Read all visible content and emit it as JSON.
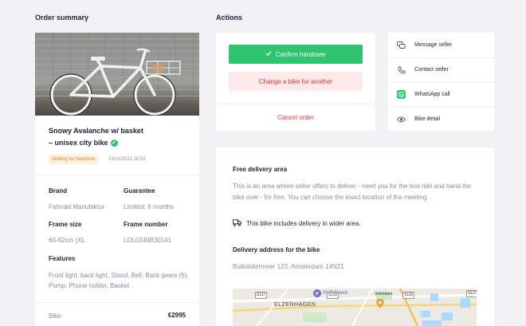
{
  "sections": {
    "order_summary": "Order summary",
    "actions": "Actions"
  },
  "order": {
    "title_line1": "Snowy Avalanche w/ basket",
    "title_line2": "– unisex city bike",
    "status": "Waiting for handover",
    "date": "21/01/2021 16:52",
    "brand_label": "Brand",
    "brand_value": "Fahrrad Manufaktur",
    "guarantee_label": "Guarantee",
    "guarantee_value": "Limited; 6 months",
    "frame_size_label": "Frame size",
    "frame_size_value": "60-62cm (XL",
    "frame_number_label": "Frame number",
    "frame_number_value": "LDL0249B30141",
    "features_label": "Features",
    "features_value": "Front light, back light, Stand, Bell, Back gears (6), Pump, Phone holder, Basket",
    "price_label": "Bike",
    "price_value": "€2995"
  },
  "actions": {
    "confirm": "Confirm handover",
    "change": "Change a bike for another",
    "cancel": "Cancel order"
  },
  "contact": {
    "items": [
      {
        "label": "Message seller",
        "icon": "chat-icon"
      },
      {
        "label": "Contact seller",
        "icon": "phone-icon"
      },
      {
        "label": "WhatsApp call",
        "icon": "whatsapp-icon"
      },
      {
        "label": "Bike detail",
        "icon": "eye-icon"
      }
    ]
  },
  "delivery": {
    "free_heading": "Free delivery area",
    "free_text": "This is an area where seller offers to deliver - meet you for the test ride and hand the bike over - for free. You can choose the exact location of the meeting.",
    "wider_note": "This bike includes delivery in wider area.",
    "address_heading": "Delivery address for the bike",
    "address": "Buikslotermeer 123, Amsterdam 14N21"
  },
  "map": {
    "labels": [
      "P+R Noord",
      "ELZENHAGEN",
      "Volendam",
      "S117",
      "S116",
      "S116",
      "S117"
    ]
  },
  "colors": {
    "accent_green": "#2ec470",
    "danger_red": "#e0343f",
    "badge_orange": "#e08a2c"
  }
}
